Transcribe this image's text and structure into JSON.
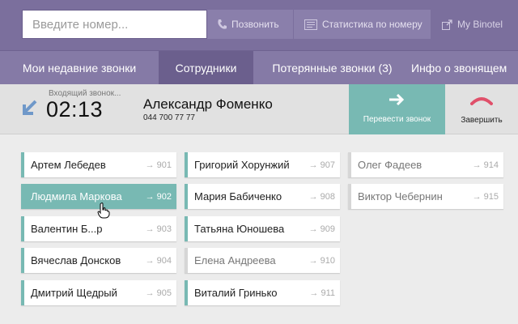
{
  "search": {
    "placeholder": "Введите номер..."
  },
  "topbar": {
    "call_label": "Позвонить",
    "stats_label": "Статистика по номеру",
    "my_label": "My Binotel"
  },
  "nav": {
    "tabs": [
      {
        "label": "Мои недавние звонки",
        "active": false
      },
      {
        "label": "Сотрудники",
        "active": true
      },
      {
        "label": "Потерянные звонки (3)",
        "active": false
      },
      {
        "label": "Инфо о звонящем",
        "active": false
      }
    ]
  },
  "call": {
    "label": "Входящий звонок...",
    "time": "02:13",
    "caller_name": "Александр Фоменко",
    "caller_number": "044 700 77 77",
    "transfer_label": "Перевести звонок",
    "finish_label": "Завершить"
  },
  "employees": {
    "col1": [
      {
        "name": "Артем Лебедев",
        "ext": "→ 901",
        "state": "normal"
      },
      {
        "name": "Людмила Маркова",
        "ext": "→ 902",
        "state": "active"
      },
      {
        "name": "Валентин Б...р",
        "ext": "→ 903",
        "state": "normal"
      },
      {
        "name": "Вячеслав Донсков",
        "ext": "→ 904",
        "state": "normal"
      },
      {
        "name": "Дмитрий Щедрый",
        "ext": "→ 905",
        "state": "normal"
      }
    ],
    "col2": [
      {
        "name": "Григорий Хорунжий",
        "ext": "→ 907",
        "state": "normal"
      },
      {
        "name": "Мария Бабиченко",
        "ext": "→ 908",
        "state": "normal"
      },
      {
        "name": "Татьяна Юношева",
        "ext": "→ 909",
        "state": "normal"
      },
      {
        "name": "Елена Андреева",
        "ext": "→ 910",
        "state": "inactive"
      },
      {
        "name": "Виталий Гринько",
        "ext": "→ 911",
        "state": "normal"
      }
    ],
    "col3": [
      {
        "name": "Олег Фадеев",
        "ext": "→ 914",
        "state": "inactive"
      },
      {
        "name": "Виктор Чебернин",
        "ext": "→ 915",
        "state": "inactive"
      }
    ]
  },
  "colors": {
    "accent": "#78b9b3",
    "topbar": "#7b6f9d",
    "nav": "#857aa6",
    "nav_active": "#6b5f8d"
  }
}
